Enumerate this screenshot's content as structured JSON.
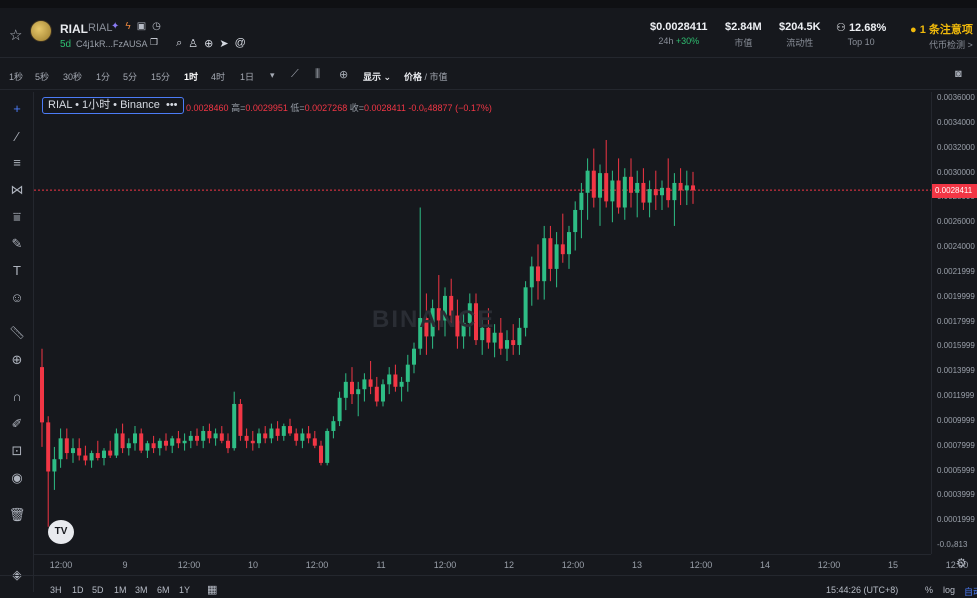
{
  "header": {
    "symbol": "RIAL",
    "symbol_sub": "RIAL",
    "age": "5d",
    "address": "C4j1kR...FzAUSA",
    "stats": [
      {
        "value": "$0.0028411",
        "label_prefix": "24h",
        "label_change": "+30%"
      },
      {
        "value": "$2.84M",
        "label": "市值"
      },
      {
        "value": "$204.5K",
        "label": "流动性"
      },
      {
        "value": "12.68%",
        "label": "Top 10"
      }
    ],
    "alert": "1 条注意项",
    "alert_sub": "代币检测 >"
  },
  "toolbar": {
    "intervals": [
      "1秒",
      "5秒",
      "30秒",
      "1分",
      "5分",
      "15分",
      "1时",
      "4时",
      "1日"
    ],
    "active_interval": "1时",
    "display_label": "显示",
    "price_label": "价格",
    "mcap_label": "市值"
  },
  "legend": {
    "title": "RIAL • 1小时 • Binance",
    "more": "•••"
  },
  "ohlc": {
    "open": "0.0028460",
    "high": "0.0029951",
    "low": "0.0027268",
    "close": "0.0028411",
    "change": "-0.0₆48877",
    "change_pct": "(−0.17%)",
    "high_label": "高=",
    "low_label": "低=",
    "close_label": "收="
  },
  "price_axis": {
    "ticks": [
      "0.0036000",
      "0.0034000",
      "0.0032000",
      "0.0030000",
      "0.0028000",
      "0.0026000",
      "0.0024000",
      "0.0021999",
      "0.0019999",
      "0.0017999",
      "0.0015999",
      "0.0013999",
      "0.0011999",
      "0.0009999",
      "0.0007999",
      "0.0005999",
      "0.0003999",
      "0.0001999",
      "-0.0₄813"
    ],
    "current": "0.0028411"
  },
  "time_axis": {
    "ticks": [
      "12:00",
      "9",
      "12:00",
      "10",
      "12:00",
      "11",
      "12:00",
      "12",
      "12:00",
      "13",
      "12:00",
      "14",
      "12:00",
      "15",
      "12:00"
    ]
  },
  "bottom": {
    "ranges": [
      "3H",
      "1D",
      "5D",
      "1M",
      "3M",
      "6M",
      "1Y"
    ],
    "clock": "15:44:26 (UTC+8)",
    "percent": "%",
    "log": "log",
    "auto": "自动"
  },
  "watermark": "BINANCE",
  "tv_logo": "TV",
  "colors": {
    "up": "#2ebd85",
    "down": "#f23645",
    "bg": "#16181d",
    "accent": "#4c7cf7",
    "alert": "#f0b90b"
  },
  "chart_data": {
    "type": "candlestick",
    "interval": "1h",
    "ylim": [
      -8.13e-05,
      0.0036
    ],
    "last_price": 0.0028411,
    "candles": [
      [
        0.0014,
        0.00155,
        0.00075,
        0.00095
      ],
      [
        0.00095,
        0.001,
        0.0001,
        0.00055
      ],
      [
        0.00055,
        0.00075,
        0.0004,
        0.00065
      ],
      [
        0.00065,
        0.0009,
        0.00058,
        0.00082
      ],
      [
        0.00082,
        0.0009,
        0.00065,
        0.0007
      ],
      [
        0.0007,
        0.00082,
        0.00062,
        0.00074
      ],
      [
        0.00074,
        0.00082,
        0.00064,
        0.00068
      ],
      [
        0.00068,
        0.00076,
        0.0006,
        0.00064
      ],
      [
        0.00064,
        0.00072,
        0.00058,
        0.0007
      ],
      [
        0.0007,
        0.0008,
        0.00064,
        0.00066
      ],
      [
        0.00066,
        0.00074,
        0.0006,
        0.00072
      ],
      [
        0.00072,
        0.0008,
        0.00066,
        0.00068
      ],
      [
        0.00068,
        0.0009,
        0.00066,
        0.00086
      ],
      [
        0.00086,
        0.00094,
        0.0007,
        0.00074
      ],
      [
        0.00074,
        0.00082,
        0.00068,
        0.00078
      ],
      [
        0.00078,
        0.00092,
        0.00072,
        0.00086
      ],
      [
        0.00086,
        0.0009,
        0.0007,
        0.00072
      ],
      [
        0.00072,
        0.0008,
        0.00066,
        0.00078
      ],
      [
        0.00078,
        0.00084,
        0.0007,
        0.00074
      ],
      [
        0.00074,
        0.00082,
        0.00068,
        0.0008
      ],
      [
        0.0008,
        0.00086,
        0.00072,
        0.00076
      ],
      [
        0.00076,
        0.00084,
        0.0007,
        0.00082
      ],
      [
        0.00082,
        0.00088,
        0.00074,
        0.00078
      ],
      [
        0.00078,
        0.00086,
        0.00072,
        0.0008
      ],
      [
        0.0008,
        0.00088,
        0.00074,
        0.00084
      ],
      [
        0.00084,
        0.0009,
        0.00076,
        0.0008
      ],
      [
        0.0008,
        0.00092,
        0.00074,
        0.00088
      ],
      [
        0.00088,
        0.00094,
        0.00078,
        0.00082
      ],
      [
        0.00082,
        0.0009,
        0.00076,
        0.00086
      ],
      [
        0.00086,
        0.00092,
        0.00078,
        0.0008
      ],
      [
        0.0008,
        0.00086,
        0.0007,
        0.00074
      ],
      [
        0.00074,
        0.0012,
        0.00072,
        0.0011
      ],
      [
        0.0011,
        0.00114,
        0.0008,
        0.00084
      ],
      [
        0.00084,
        0.0009,
        0.00074,
        0.0008
      ],
      [
        0.0008,
        0.00088,
        0.00072,
        0.00078
      ],
      [
        0.00078,
        0.0009,
        0.00074,
        0.00086
      ],
      [
        0.00086,
        0.00092,
        0.00078,
        0.00082
      ],
      [
        0.00082,
        0.00094,
        0.00078,
        0.0009
      ],
      [
        0.0009,
        0.00096,
        0.0008,
        0.00084
      ],
      [
        0.00084,
        0.00094,
        0.0008,
        0.00092
      ],
      [
        0.00092,
        0.00098,
        0.00084,
        0.00086
      ],
      [
        0.00086,
        0.0009,
        0.00076,
        0.0008
      ],
      [
        0.0008,
        0.0009,
        0.00074,
        0.00086
      ],
      [
        0.00086,
        0.00092,
        0.00078,
        0.00082
      ],
      [
        0.00082,
        0.00088,
        0.00074,
        0.00076
      ],
      [
        0.00076,
        0.0008,
        0.0006,
        0.00062
      ],
      [
        0.00062,
        0.0009,
        0.0006,
        0.00088
      ],
      [
        0.00088,
        0.001,
        0.00082,
        0.00096
      ],
      [
        0.00096,
        0.0012,
        0.00092,
        0.00115
      ],
      [
        0.00115,
        0.00135,
        0.00105,
        0.00128
      ],
      [
        0.00128,
        0.0014,
        0.0011,
        0.00118
      ],
      [
        0.00118,
        0.00128,
        0.001,
        0.00122
      ],
      [
        0.00122,
        0.00135,
        0.00112,
        0.0013
      ],
      [
        0.0013,
        0.00145,
        0.00118,
        0.00124
      ],
      [
        0.00124,
        0.00132,
        0.00108,
        0.00112
      ],
      [
        0.00112,
        0.0013,
        0.00108,
        0.00126
      ],
      [
        0.00126,
        0.0014,
        0.00118,
        0.00134
      ],
      [
        0.00134,
        0.00142,
        0.0012,
        0.00124
      ],
      [
        0.00124,
        0.00132,
        0.00112,
        0.00128
      ],
      [
        0.00128,
        0.0015,
        0.0012,
        0.00142
      ],
      [
        0.00142,
        0.0016,
        0.00135,
        0.00155
      ],
      [
        0.00155,
        0.0027,
        0.0015,
        0.0018
      ],
      [
        0.0018,
        0.002,
        0.0015,
        0.00165
      ],
      [
        0.00165,
        0.00195,
        0.00155,
        0.00188
      ],
      [
        0.00188,
        0.00215,
        0.0017,
        0.00178
      ],
      [
        0.00178,
        0.00205,
        0.00165,
        0.00198
      ],
      [
        0.00198,
        0.00212,
        0.00175,
        0.00182
      ],
      [
        0.00182,
        0.00195,
        0.00155,
        0.00165
      ],
      [
        0.00165,
        0.00185,
        0.00155,
        0.00176
      ],
      [
        0.00176,
        0.002,
        0.00165,
        0.00192
      ],
      [
        0.00192,
        0.002,
        0.00158,
        0.00162
      ],
      [
        0.00162,
        0.0018,
        0.0015,
        0.00172
      ],
      [
        0.00172,
        0.00188,
        0.00155,
        0.0016
      ],
      [
        0.0016,
        0.00175,
        0.00148,
        0.00168
      ],
      [
        0.00168,
        0.0018,
        0.0015,
        0.00155
      ],
      [
        0.00155,
        0.0017,
        0.00145,
        0.00162
      ],
      [
        0.00162,
        0.00175,
        0.0015,
        0.00158
      ],
      [
        0.00158,
        0.0018,
        0.0015,
        0.00172
      ],
      [
        0.00172,
        0.0021,
        0.00165,
        0.00205
      ],
      [
        0.00205,
        0.0023,
        0.0019,
        0.00222
      ],
      [
        0.00222,
        0.0024,
        0.00195,
        0.0021
      ],
      [
        0.0021,
        0.00255,
        0.00195,
        0.00245
      ],
      [
        0.00245,
        0.00255,
        0.0021,
        0.0022
      ],
      [
        0.0022,
        0.0025,
        0.00205,
        0.0024
      ],
      [
        0.0024,
        0.00265,
        0.00225,
        0.00232
      ],
      [
        0.00232,
        0.00255,
        0.0022,
        0.0025
      ],
      [
        0.0025,
        0.00275,
        0.00235,
        0.00268
      ],
      [
        0.00268,
        0.0029,
        0.00245,
        0.00282
      ],
      [
        0.00282,
        0.0031,
        0.0026,
        0.003
      ],
      [
        0.003,
        0.00318,
        0.0027,
        0.00278
      ],
      [
        0.00278,
        0.00305,
        0.00255,
        0.00298
      ],
      [
        0.00298,
        0.00325,
        0.0027,
        0.00275
      ],
      [
        0.00275,
        0.003,
        0.00258,
        0.00292
      ],
      [
        0.00292,
        0.0031,
        0.00265,
        0.0027
      ],
      [
        0.0027,
        0.00302,
        0.0026,
        0.00295
      ],
      [
        0.00295,
        0.0031,
        0.0027,
        0.00282
      ],
      [
        0.00282,
        0.003,
        0.00262,
        0.0029
      ],
      [
        0.0029,
        0.00302,
        0.00268,
        0.00274
      ],
      [
        0.00274,
        0.00292,
        0.00262,
        0.00285
      ],
      [
        0.00285,
        0.003,
        0.00268,
        0.0028
      ],
      [
        0.0028,
        0.00292,
        0.00268,
        0.00286
      ],
      [
        0.00286,
        0.0031,
        0.0027,
        0.00276
      ],
      [
        0.00276,
        0.00298,
        0.00255,
        0.0029
      ],
      [
        0.0029,
        0.00302,
        0.00272,
        0.00284
      ],
      [
        0.00284,
        0.003,
        0.00272,
        0.00288
      ],
      [
        0.00288,
        0.00299,
        0.00273,
        0.00284
      ]
    ]
  }
}
